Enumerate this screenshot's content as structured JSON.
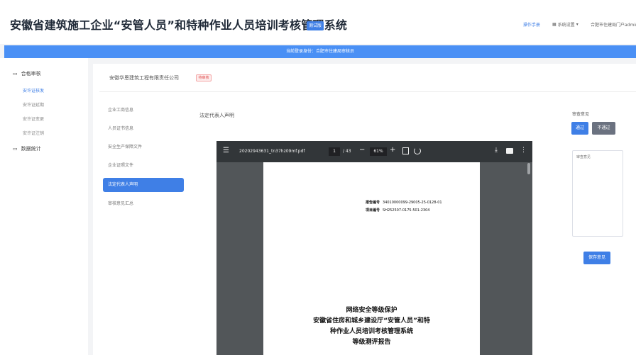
{
  "header": {
    "title": "安徽省建筑施工企业“安管人员”和特种作业人员培训考核管理系统",
    "badge": "测试版",
    "help_link": "操作手册",
    "settings_label": "系统设置",
    "user_label": "合肥市住建局门户admin"
  },
  "notice": {
    "text": "当前登录身份：合肥市住建局审核员"
  },
  "sidebar": {
    "groups": [
      {
        "label": "合格审核",
        "items": [
          "安许证核发",
          "安许证延期",
          "安许证变更",
          "安许证注销"
        ]
      },
      {
        "label": "数据统计",
        "items": []
      }
    ],
    "active_item": "安许证核发"
  },
  "company": {
    "name": "安徽华恩建筑工程有限责任公司",
    "tag": "待审核"
  },
  "doc_nav": {
    "items": [
      "企业工商信息",
      "人员证书信息",
      "安全生产保障文件",
      "企业证照文件",
      "法定代表人声明",
      "审核意见汇总"
    ],
    "active_index": 4
  },
  "section": {
    "label": "法定代表人声明"
  },
  "pdf_viewer": {
    "filename": "20202943631_tn37hz09mf.pdf",
    "current_page": "1",
    "total_pages": "/ 43",
    "zoom": "61%",
    "report_no_label": "报告编号",
    "report_no_value": "34010000099-29005-25-0128-01",
    "project_no_label": "项目编号",
    "project_no_value": "SH252507-0175-501-2304",
    "title_lines": [
      "网络安全等级保护",
      "安徽省住房和城乡建设厅“安管人员”和特",
      "种作业人员培训考核管理系统",
      "等级测评报告"
    ]
  },
  "review": {
    "label": "审查意见",
    "pass_label": "通过",
    "fail_label": "不通过",
    "textarea_placeholder": "审查意见",
    "submit_label": "保存意见"
  },
  "colors": {
    "primary": "#3f7fe6",
    "notice_bg": "#4a90f5",
    "viewer_bg": "#525659",
    "viewer_toolbar": "#323639",
    "tag_red": "#e05252"
  }
}
